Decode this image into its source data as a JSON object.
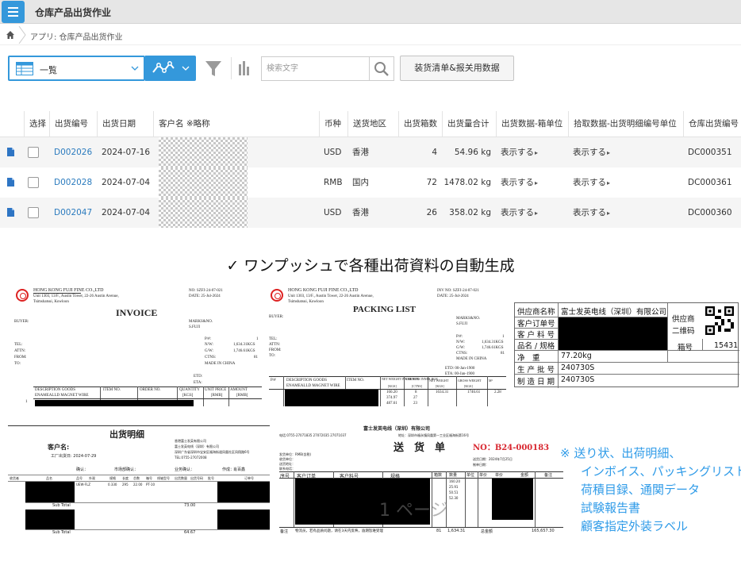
{
  "header": {
    "title": "仓库产品出货作业"
  },
  "breadcrumb": {
    "text": "アプリ: 仓库产品出货作业"
  },
  "toolbar": {
    "view_label": "一覧",
    "search_placeholder": "検索文字",
    "action_label": "装货清单&报关用数据"
  },
  "table": {
    "headers": [
      "选择",
      "出货编号",
      "出货日期",
      "客户名 ※略称",
      "币种",
      "送货地区",
      "出货箱数",
      "出货量合计",
      "出货数据-箱单位",
      "拾取数据-出货明细编号单位",
      "仓库出货编号"
    ],
    "rows": [
      {
        "id": "D002026",
        "date": "2024-07-16",
        "currency": "USD",
        "region": "香港",
        "boxes": "4",
        "weight": "54.96 kg",
        "box_data": "表示する",
        "pick_data": "表示する",
        "wh_no": "DC000351"
      },
      {
        "id": "D002028",
        "date": "2024-07-04",
        "currency": "RMB",
        "region": "国内",
        "boxes": "72",
        "weight": "1478.02 kg",
        "box_data": "表示する",
        "pick_data": "表示する",
        "wh_no": "DC000361"
      },
      {
        "id": "D002047",
        "date": "2024-07-04",
        "currency": "USD",
        "region": "香港",
        "boxes": "26",
        "weight": "358.02 kg",
        "box_data": "表示する",
        "pick_data": "表示する",
        "wh_no": "DC000360"
      }
    ]
  },
  "tagline": "ワンプッシュで各種出荷資料の自動生成",
  "docs": {
    "invoice": {
      "company": "HONG KONG FUJI FINE CO.,LTD",
      "address": "Unit 1303, 13/F., Austin Tower, 22-26 Austin Avenue,",
      "city": "Tsimshatsui, Kowloon",
      "no": "NO: SZFJ-24-07-021",
      "date": "DATE: 25-Jul-2024",
      "title": "INVOICE",
      "buyer": "BUYER:",
      "marks": "MARKS&NO.",
      "marks_val": "S.FUJI",
      "pno": "P/#:",
      "pno_val": "1",
      "nw": "N/W:",
      "nw_val": "1,634.31KGS",
      "gw": "G/W:",
      "gw_val": "1,746.61KGS",
      "ctns": "CTNS:",
      "ctns_val": "81",
      "made": "MADE IN CHINA",
      "tel": "TEL:",
      "attn": "ATTN:",
      "from": "FROM:",
      "to": "TO:",
      "etd": "ETD:",
      "eta": "ETA:",
      "col1": "DESCRIPTION GOODS",
      "col1b": "ENAMEALLD MAGNET WIRE",
      "col2": "ITEM NO.",
      "col3": "ORDER NO.",
      "col4": "QUANTITY",
      "col4b": "[KGS]",
      "col5": "UNIT PRICE",
      "col5b": "[RMB]",
      "col6": "AMOUNT",
      "col6b": "[RMB]",
      "row1": "1"
    },
    "packing": {
      "company": "HONG KONG FUJI FINE CO.,LTD",
      "address": "Unit 1303, 13/F., Austin Tower, 22-26 Austin Avenue,",
      "city": "Tsimshatsui, Kowloon",
      "no": "INV NO: SZFJ-24-07-021",
      "date": "DATE: 25-Jul-2024",
      "title": "PACKING LIST",
      "buyer": "BUYER:",
      "marks": "MARKS&NO.",
      "marks_val": "S.FUJI",
      "pno": "P/#:",
      "pno_val": "1",
      "nw": "N/W:",
      "nw_val": "1,634.31KGS",
      "gw": "G/W:",
      "gw_val": "1,746.61KGS",
      "ctns": "CTNS:",
      "ctns_val": "81",
      "made": "MADE IN CHINA",
      "tel": "TEL:",
      "attn": "ATTN:",
      "from": "FROM:",
      "to": "TO:",
      "etd": "ETD: 00-Jan-1900",
      "eta": "ETA: 00-Jan-1900",
      "col0": "P/#",
      "col1": "DESCRIPTION GOODS",
      "col1b": "ENAMEALLD MAGNET WIRE",
      "col2": "ITEM NO.",
      "col3": "NET WEIGHT INNER BOX",
      "col3b": "[KGS]",
      "col4": "CARTONS INNER BOX",
      "col4b": "[CTNS]",
      "col5": "NET WEIGHT",
      "col5b": "[KGS]",
      "col6": "GROSS WEIGHT",
      "col6b": "[KGS]",
      "col7": "M³",
      "v1": "160.20",
      "v2": "374.97",
      "v3": "487.61",
      "c1": "8",
      "c2": "27",
      "c3": "23",
      "tot1": "1634.31",
      "tot2": "1746.61",
      "tot3": "2.28"
    },
    "label": {
      "supplier_label": "供应商名称",
      "supplier_value": "富士发英电线（深圳）有限公司",
      "order_label": "客户订单号",
      "part_label": "客 户 料 号",
      "name_label": "品名 / 规格",
      "net_label": "净　重",
      "net_value": "77.20kg",
      "lot_label": "生 产 批 号",
      "lot_value": "240730S",
      "date_label": "制 造 日 期",
      "date_value": "240730S",
      "qr_label1": "供应商",
      "qr_label2": "二维码",
      "box_label": "箱号",
      "box_value": "15431"
    },
    "detail": {
      "title": "出货明细",
      "customer": "客户名:",
      "issue_date": "工厂出货日: 2024-07-29",
      "confirm": "确认：",
      "mgr_confirm": "市场部确认：",
      "biz_confirm": "业务确认：",
      "person": "作成：",
      "person_name": "肖百鑫",
      "addr1": "香港富士发英有限公司",
      "addr2": "富士发英电线（深圳）有限公司",
      "addr3": "深圳广东省深圳市宝安区福海街道凤凰社区凤翔路6号",
      "addr4": "TEL:0755-27072008",
      "h1": "收货者",
      "h2": "品名",
      "h3": "品号",
      "h4": "外观",
      "h5": "规格",
      "h6": "长度",
      "h7": "芯数",
      "h8": "箱号",
      "h9": "线轴型号",
      "h10": "出货数量",
      "h11": "出货号码",
      "h12": "批号",
      "h13": "订单号",
      "sub_total": "Sub Total",
      "sub1": "73.00",
      "sub2": "64.67",
      "r_code": "UEW-FLZ",
      "r_spec": "0.330",
      "r_qty": "295",
      "r_len": "22.00",
      "r_reel": "PT-10"
    },
    "waybill": {
      "company": "富士发英电线（深圳）有限公司",
      "tel": "电话:0755-27071835 27072035 27071037",
      "addr": "地址：深圳市福永镇凤凰第一工业区福海街第16号",
      "title": "送　货　单",
      "no": "NO：B24-000183",
      "unit": "发货单位：RMB(含税)",
      "to": "收货单位：",
      "addr2": "送货地址：",
      "contact": "联系电话：",
      "send_date": "送货日期：2024年7月25日",
      "ship_date": "制单日期：",
      "h0": "序号",
      "h1": "客户订单",
      "h2": "客户料号",
      "h3": "规格",
      "h4": "箱数",
      "h5": "数量",
      "h6": "单位",
      "h7": "单价",
      "h8": "单价",
      "h9": "金额",
      "h10": "备注",
      "watermark": "1 ページ",
      "note": "备注",
      "note_text": "物流员，若有品质问题，请在3天内反映，逾期恕难受理",
      "total_boxes": "81",
      "total_qty": "1,634.31",
      "total_label": "总金额",
      "total_amt": "165,657.30",
      "q1": "160.20",
      "q2": "25.91",
      "q3": "50.51",
      "q4": "52.30"
    }
  },
  "note": {
    "lines": [
      "※ 送り状、出荷明細、",
      "インボイス、パッキングリスト",
      "荷積目録、通関データ",
      "試験報告書",
      "顧客指定外装ラベル"
    ]
  }
}
